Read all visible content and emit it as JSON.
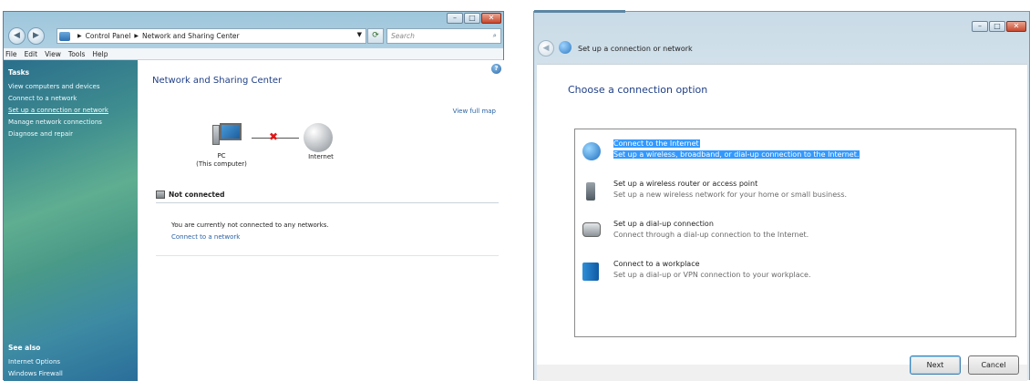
{
  "explorer": {
    "caption_buttons": [
      "–",
      "□",
      "✕"
    ],
    "address": {
      "parts": [
        "Control Panel",
        "Network and Sharing Center"
      ]
    },
    "search_placeholder": "Search",
    "menu": [
      "File",
      "Edit",
      "View",
      "Tools",
      "Help"
    ],
    "tasks": {
      "heading": "Tasks",
      "items": [
        "View computers and devices",
        "Connect to a network",
        "Set up a connection or network",
        "Manage network connections",
        "Diagnose and repair"
      ]
    },
    "see_also": {
      "heading": "See also",
      "items": [
        "Internet Options",
        "Windows Firewall"
      ]
    },
    "content": {
      "title": "Network and Sharing Center",
      "view_full_map": "View full map",
      "pc_label_1": "PC",
      "pc_label_2": "(This computer)",
      "internet_label": "Internet",
      "status_title": "Not connected",
      "status_message": "You are currently not connected to any networks.",
      "status_link": "Connect to a network"
    }
  },
  "wizard": {
    "caption_buttons": [
      "–",
      "□",
      "✕"
    ],
    "title": "Set up a connection or network",
    "heading": "Choose a connection option",
    "options": [
      {
        "title": "Connect to the Internet",
        "desc": "Set up a wireless, broadband, or dial-up connection to the Internet.",
        "selected": true,
        "icon": "globe-icon"
      },
      {
        "title": "Set up a wireless router or access point",
        "desc": "Set up a new wireless network for your home or small business.",
        "selected": false,
        "icon": "router-icon"
      },
      {
        "title": "Set up a dial-up connection",
        "desc": "Connect through a dial-up connection to the Internet.",
        "selected": false,
        "icon": "phone-icon"
      },
      {
        "title": "Connect to a workplace",
        "desc": "Set up a dial-up or VPN connection to your workplace.",
        "selected": false,
        "icon": "workplace-icon"
      }
    ],
    "next_label": "Next",
    "cancel_label": "Cancel"
  },
  "colors": {
    "selection": "#3399ff",
    "title_blue": "#1f3f87",
    "link_blue": "#2a62a5",
    "error_red": "#e01818"
  }
}
